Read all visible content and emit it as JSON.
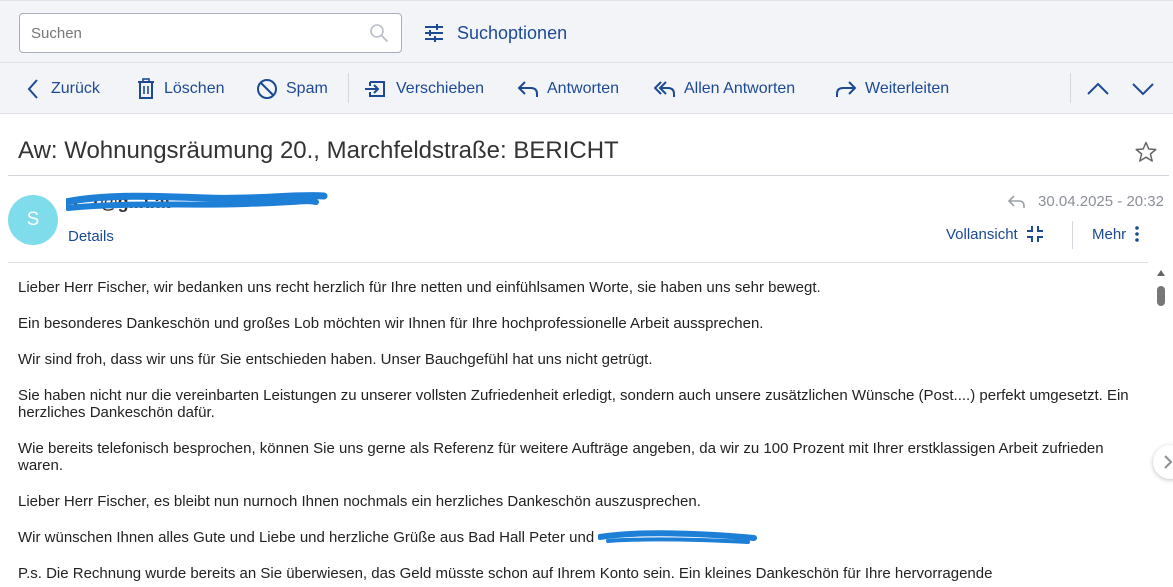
{
  "search": {
    "placeholder": "Suchen",
    "options_label": "Suchoptionen"
  },
  "toolbar": {
    "back": "Zurück",
    "delete": "Löschen",
    "spam": "Spam",
    "move": "Verschieben",
    "reply": "Antworten",
    "reply_all": "Allen Antworten",
    "forward": "Weiterleiten"
  },
  "message": {
    "subject": "Aw: Wohnungsräumung 20., Marchfeldstraße: BERICHT",
    "avatar_letter": "S",
    "sender_visible": "s...r@g...t.at",
    "details_label": "Details",
    "date": "30.04.2025 - 20:32",
    "fullview_label": "Vollansicht",
    "more_label": "Mehr",
    "body": [
      "Lieber Herr Fischer, wir bedanken uns recht herzlich für Ihre netten und einfühlsamen Worte, sie haben uns sehr bewegt.",
      "Ein besonderes Dankeschön und großes Lob möchten wir Ihnen für Ihre hochprofessionelle Arbeit aussprechen.",
      "Wir sind froh, dass wir uns für Sie entschieden haben. Unser Bauchgefühl hat uns nicht getrügt.",
      "Sie haben nicht nur die vereinbarten Leistungen zu unserer vollsten Zufriedenheit erledigt, sondern auch unsere zusätzlichen Wünsche (Post....) perfekt umgesetzt. Ein herzliches Dankeschön dafür.",
      "Wie bereits telefonisch besprochen, können Sie uns gerne als Referenz für weitere Aufträge angeben, da wir zu 100 Prozent mit Ihrer erstklassigen Arbeit zufrieden waren.",
      "Lieber Herr Fischer, es bleibt nun nurnoch Ihnen nochmals ein herzliches Dankeschön auszusprechen.",
      "Wir wünschen Ihnen alles Gute und Liebe und herzliche Grüße aus Bad Hall Peter und",
      "P.s. Die Rechnung wurde bereits an Sie überwiesen, das Geld müsste schon auf Ihrem Konto sein. Ein kleines Dankeschön für Ihre hervorragende"
    ]
  },
  "colors": {
    "accent": "#1c4a94",
    "avatar_bg": "#7fdcea",
    "redaction": "#1e7fd6",
    "toolbar_bg": "#f3f4f7"
  }
}
